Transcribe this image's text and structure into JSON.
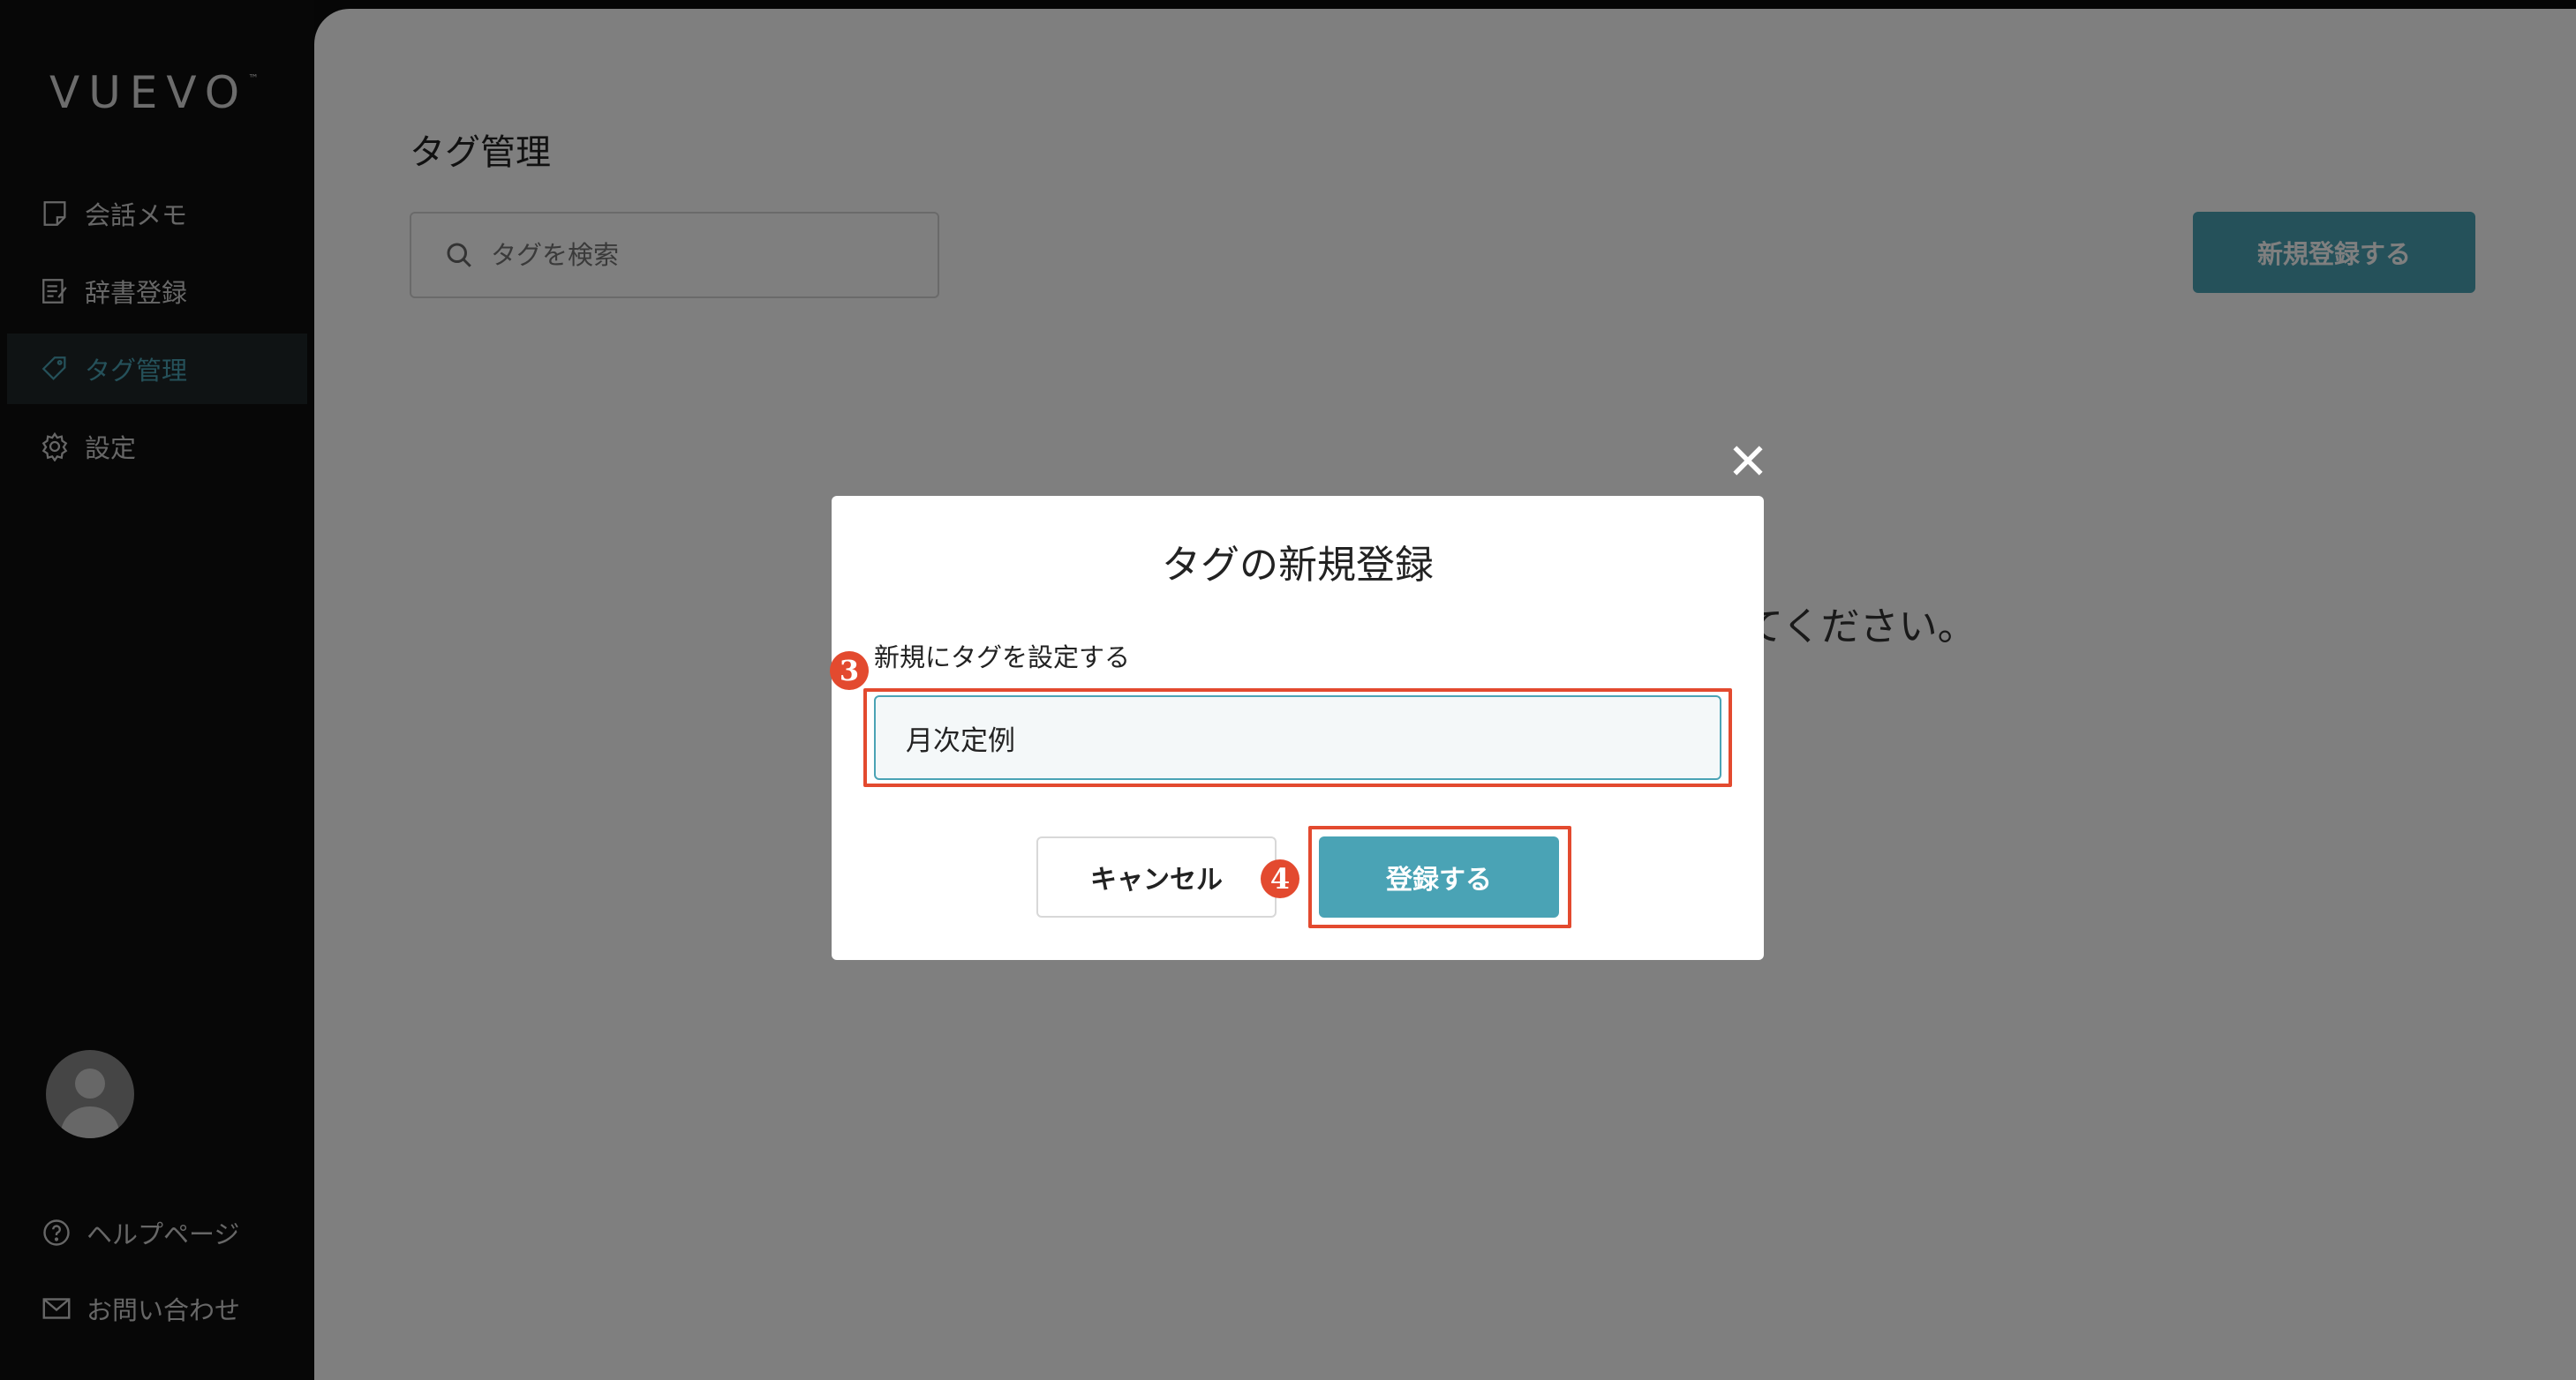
{
  "app": {
    "logo": "VUEVO",
    "logo_tm": "™"
  },
  "sidebar": {
    "items": [
      {
        "label": "会話メモ",
        "icon": "note-icon",
        "active": false
      },
      {
        "label": "辞書登録",
        "icon": "dictionary-icon",
        "active": false
      },
      {
        "label": "タグ管理",
        "icon": "tag-icon",
        "active": true
      },
      {
        "label": "設定",
        "icon": "gear-icon",
        "active": false
      }
    ],
    "bottom_links": [
      {
        "label": "ヘルプページ",
        "icon": "help-icon"
      },
      {
        "label": "お問い合わせ",
        "icon": "mail-icon"
      }
    ]
  },
  "main": {
    "title": "タグ管理",
    "search_placeholder": "タグを検索",
    "new_button": "新規登録する",
    "empty_message_partial": "てください。"
  },
  "modal": {
    "title": "タグの新規登録",
    "field_label": "新規にタグを設定する",
    "field_value": "月次定例",
    "cancel_label": "キャンセル",
    "submit_label": "登録する",
    "step_badges": [
      "3",
      "4"
    ]
  },
  "colors": {
    "accent": "#4aa3b5",
    "highlight": "#e34a2f",
    "sidebar_bg": "#0e0e0e"
  }
}
